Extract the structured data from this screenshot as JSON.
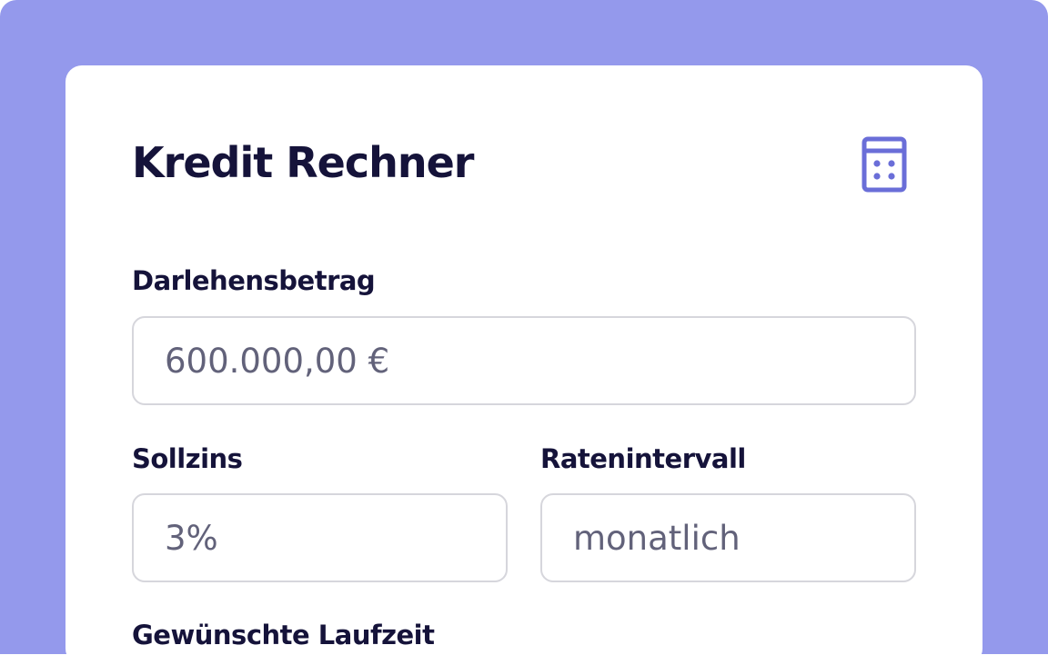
{
  "card": {
    "title": "Kredit Rechner",
    "icon": "calculator-icon"
  },
  "fields": {
    "amount": {
      "label": "Darlehensbetrag",
      "value": "600.000,00 €"
    },
    "rate": {
      "label": "Sollzins",
      "value": "3%"
    },
    "interval": {
      "label": "Ratenintervall",
      "value": "monatlich"
    },
    "term": {
      "label": "Gewünschte Laufzeit"
    }
  },
  "colors": {
    "background": "#9499ec",
    "card": "#ffffff",
    "heading": "#15133a",
    "value_text": "#62627a",
    "border": "#d6d6dc",
    "icon": "#6a6ed8"
  }
}
